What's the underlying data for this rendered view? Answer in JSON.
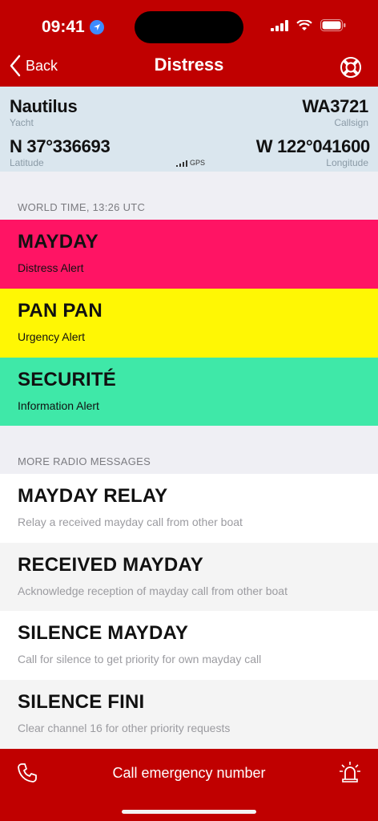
{
  "status": {
    "time": "09:41"
  },
  "nav": {
    "back_label": "Back",
    "title": "Distress"
  },
  "vessel": {
    "name": "Nautilus",
    "name_label": "Yacht",
    "callsign": "WA3721",
    "callsign_label": "Callsign",
    "latitude": "N 37°336693",
    "latitude_label": "Latitude",
    "longitude": "W 122°041600",
    "longitude_label": "Longitude",
    "gps_label": "GPS"
  },
  "sections": {
    "world_time": "WORLD TIME, 13:26 UTC",
    "more_messages": "MORE RADIO MESSAGES"
  },
  "alerts": [
    {
      "title": "MAYDAY",
      "subtitle": "Distress Alert",
      "color": "#ff1464"
    },
    {
      "title": "PAN PAN",
      "subtitle": "Urgency Alert",
      "color": "#fff704"
    },
    {
      "title": "SECURITÉ",
      "subtitle": "Information Alert",
      "color": "#3fe8a8"
    }
  ],
  "messages": [
    {
      "title": "MAYDAY RELAY",
      "subtitle": "Relay a received mayday call from other boat"
    },
    {
      "title": "RECEIVED MAYDAY",
      "subtitle": "Acknowledge reception of mayday call from other boat"
    },
    {
      "title": "SILENCE MAYDAY",
      "subtitle": "Call for silence to get priority for own mayday call"
    },
    {
      "title": "SILENCE FINI",
      "subtitle": "Clear channel 16 for other priority requests"
    }
  ],
  "bottom": {
    "call_label": "Call emergency number"
  },
  "colors": {
    "brand": "#c00000",
    "vessel_bg": "#dae6ee"
  }
}
